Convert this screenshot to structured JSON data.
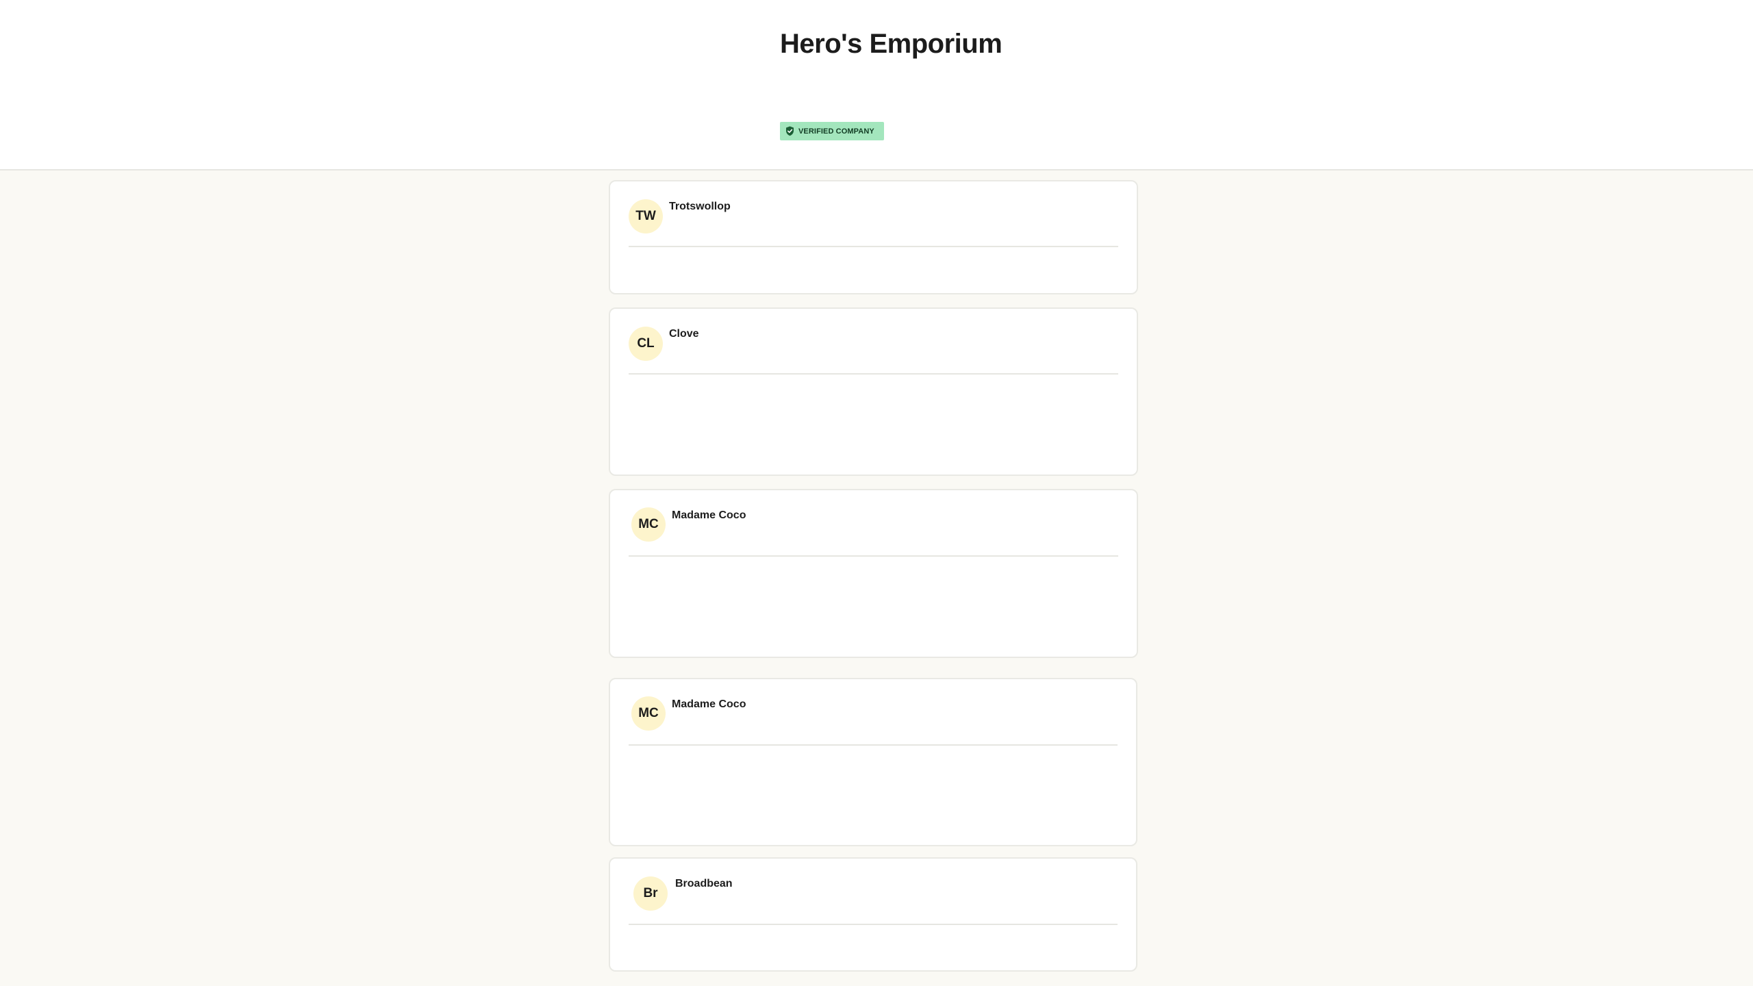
{
  "company": {
    "name": "Hero's Emporium",
    "badge": "VERIFIED COMPANY"
  },
  "reviews": [
    {
      "initials": "TW",
      "name": "Trotswollop"
    },
    {
      "initials": "CL",
      "name": "Clove"
    },
    {
      "initials": "MC",
      "name": "Madame Coco"
    },
    {
      "initials": "MC",
      "name": "Madame Coco"
    },
    {
      "initials": "Br",
      "name": "Broadbean"
    }
  ],
  "colors": {
    "page_background": "#faf9f4",
    "badge_background": "#a3e6bd",
    "avatar_background": "#fdf4cc",
    "text": "#1c1c1c"
  }
}
